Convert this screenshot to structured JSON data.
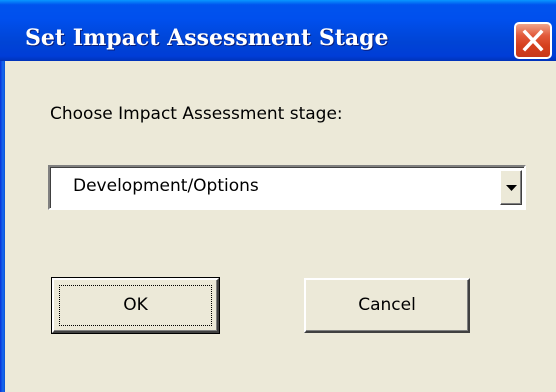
{
  "window": {
    "title": "Set Impact Assessment Stage"
  },
  "dialog": {
    "prompt_label": "Choose Impact Assessment stage:",
    "stage_select": {
      "selected_value": "Development/Options"
    },
    "ok_label": "OK",
    "cancel_label": "Cancel"
  },
  "icons": {
    "close": "close-icon",
    "dropdown": "chevron-down-icon"
  },
  "colors": {
    "titlebar": "#0050EE",
    "close_button": "#D6401E",
    "dialog_background": "#ECE9D8"
  }
}
